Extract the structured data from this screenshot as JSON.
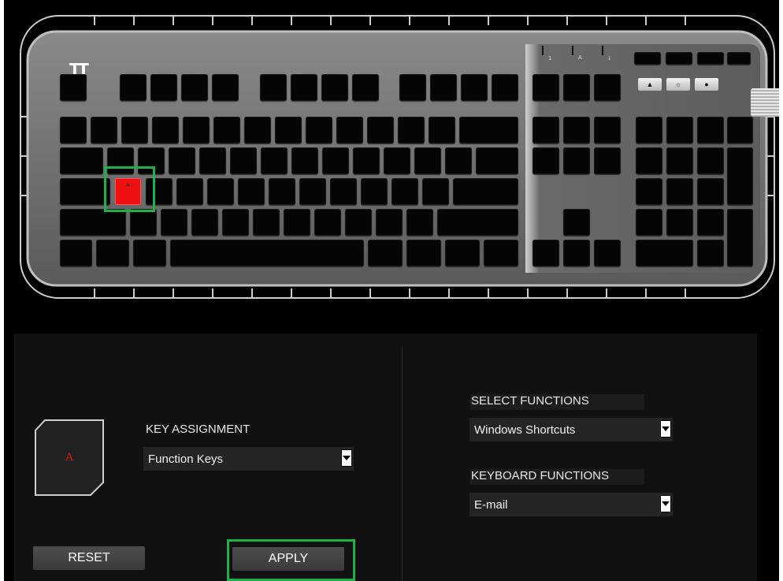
{
  "keyboard": {
    "brand_logo": "TT",
    "selected_key_label": "A",
    "led_indicators": [
      "1",
      "A",
      "↓"
    ],
    "media_buttons": [
      "▲",
      "☼",
      "●"
    ]
  },
  "key_preview": {
    "glyph": "A"
  },
  "key_assignment": {
    "label": "KEY ASSIGNMENT",
    "value": "Function Keys"
  },
  "select_functions": {
    "label": "SELECT FUNCTIONS",
    "value": "Windows Shortcuts"
  },
  "keyboard_functions": {
    "label": "KEYBOARD FUNCTIONS",
    "value": "E-mail"
  },
  "buttons": {
    "reset": "RESET",
    "apply": "APPLY"
  },
  "colors": {
    "selected_key": "#ee1111",
    "highlight": "#1db149",
    "preview_glyph": "#e01818"
  }
}
